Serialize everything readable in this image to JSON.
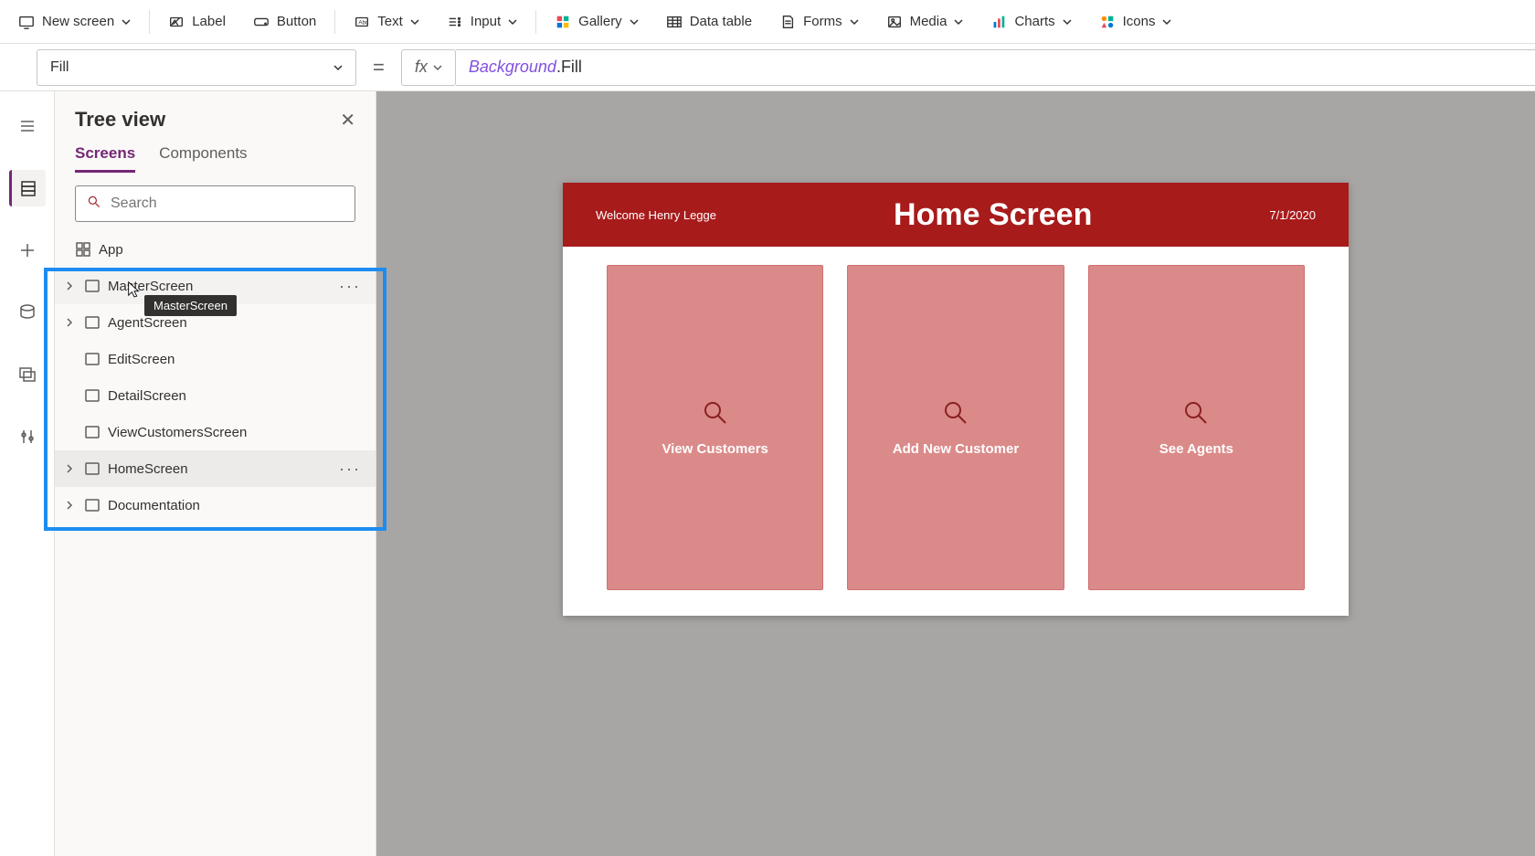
{
  "ribbon": {
    "new_screen": "New screen",
    "label": "Label",
    "button": "Button",
    "text": "Text",
    "input": "Input",
    "gallery": "Gallery",
    "data_table": "Data table",
    "forms": "Forms",
    "media": "Media",
    "charts": "Charts",
    "icons": "Icons"
  },
  "formula": {
    "property": "Fill",
    "fx": "fx",
    "expr_object": "Background",
    "expr_prop": ".Fill"
  },
  "tree": {
    "title": "Tree view",
    "tabs": {
      "screens": "Screens",
      "components": "Components"
    },
    "search_placeholder": "Search",
    "app_label": "App",
    "items": [
      {
        "label": "MasterScreen"
      },
      {
        "label": "AgentScreen"
      },
      {
        "label": "EditScreen"
      },
      {
        "label": "DetailScreen"
      },
      {
        "label": "ViewCustomersScreen"
      },
      {
        "label": "HomeScreen"
      },
      {
        "label": "Documentation"
      }
    ],
    "tooltip": "MasterScreen"
  },
  "canvas": {
    "welcome": "Welcome Henry Legge",
    "title": "Home Screen",
    "date": "7/1/2020",
    "cards": [
      {
        "label": "View Customers"
      },
      {
        "label": "Add New Customer"
      },
      {
        "label": "See Agents"
      }
    ]
  }
}
